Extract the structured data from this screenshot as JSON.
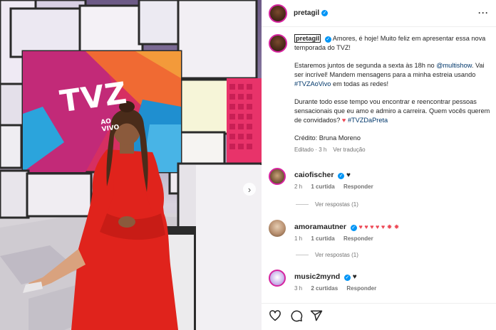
{
  "post": {
    "username": "pretagil",
    "caption": {
      "p1": "Amores, é hoje! Muito feliz em apresentar essa nova temporada do TVZ!",
      "p2_a": "Estaremos juntos de segunda a sexta às 18h no ",
      "p2_mention": "@multishow",
      "p2_b": ". Vai ser incrível! Mandem mensagens para a minha estreia usando ",
      "p2_tag": "#TVZAoVivo",
      "p2_c": " em todas as redes!",
      "p3_a": "Durante todo esse tempo vou encontrar e reencontrar pessoas sensacionais que eu amo e admiro a carreira. Quem vocês querem de convidados? ",
      "p3_heart": "♥",
      "p3_tag": " #TVZDaPreta",
      "credit": "Crédito: Bruna Moreno",
      "meta": "Editado · 3 h    Ver tradução"
    }
  },
  "comments": [
    {
      "username": "caiofischer",
      "text": "♥",
      "time": "2 h",
      "likes": "1 curtida",
      "reply": "Responder",
      "view_replies": "Ver respostas (1)"
    },
    {
      "username": "amoramautner",
      "text": "♥ ♥ ♥ ♥ ♥ ✸ ✸",
      "time": "1 h",
      "likes": "1 curtida",
      "reply": "Responder",
      "view_replies": "Ver respostas (1)"
    },
    {
      "username": "music2mynd",
      "text": "♥",
      "time": "3 h",
      "likes": "2 curtidas",
      "reply": "Responder"
    }
  ],
  "photo": {
    "sign_main": "TVZ",
    "sign_sub_1": "AO",
    "sign_sub_2": "VIVO"
  },
  "icons": [
    "verified-icon",
    "more-icon",
    "heart-icon",
    "comment-icon",
    "share-icon",
    "next-icon"
  ],
  "colors": {
    "link": "#00376b",
    "verified": "#0095f6",
    "heart": "#ed4956",
    "dress": "#e0231c"
  }
}
